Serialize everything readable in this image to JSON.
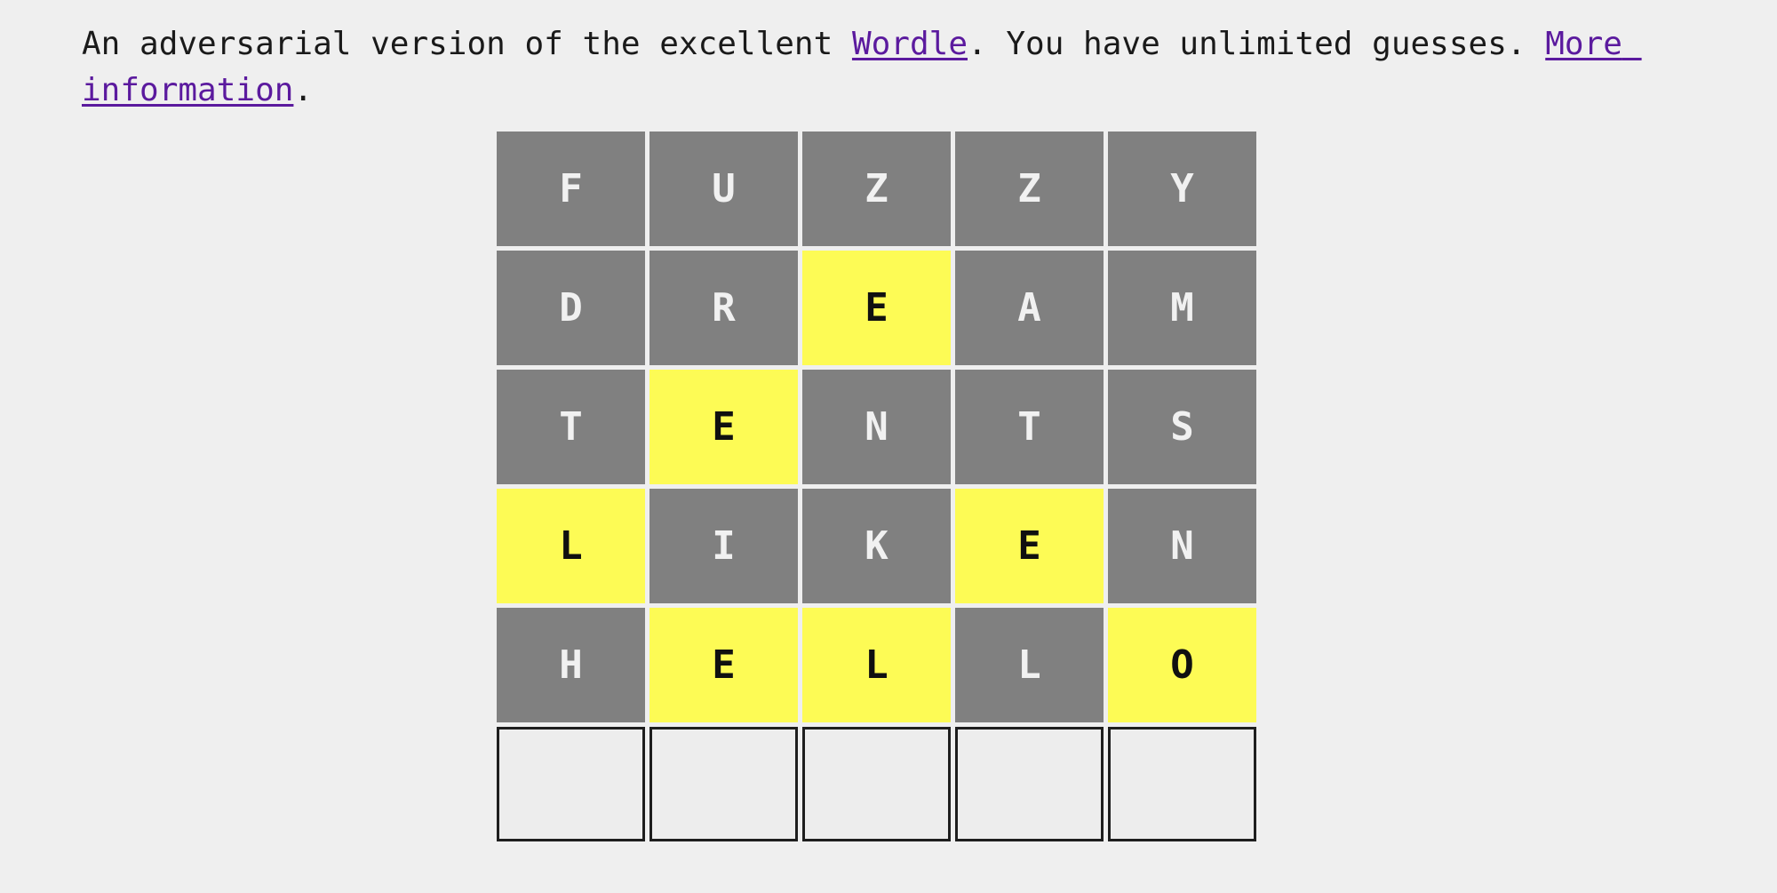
{
  "page": {
    "background_color": "#efefef",
    "link_color": "#5b1a9e"
  },
  "intro": {
    "text_before_link1": "An adversarial version of the excellent ",
    "link1_label": "Wordle",
    "text_between_links": ". You have unlimited guesses. ",
    "link2_label": "More information",
    "text_after_link2": "."
  },
  "board": {
    "columns": 5,
    "rows": 6,
    "tile_colors": {
      "absent": "#808080",
      "present": "#fdfb55",
      "empty": "#ededed",
      "absent_text": "#f1f1f1",
      "present_text": "#101010",
      "empty_border": "#1e1e1e"
    },
    "guesses": [
      {
        "word": "FUZZY",
        "tiles": [
          {
            "letter": "F",
            "state": "absent"
          },
          {
            "letter": "U",
            "state": "absent"
          },
          {
            "letter": "Z",
            "state": "absent"
          },
          {
            "letter": "Z",
            "state": "absent"
          },
          {
            "letter": "Y",
            "state": "absent"
          }
        ]
      },
      {
        "word": "DREAM",
        "tiles": [
          {
            "letter": "D",
            "state": "absent"
          },
          {
            "letter": "R",
            "state": "absent"
          },
          {
            "letter": "E",
            "state": "present"
          },
          {
            "letter": "A",
            "state": "absent"
          },
          {
            "letter": "M",
            "state": "absent"
          }
        ]
      },
      {
        "word": "TENTS",
        "tiles": [
          {
            "letter": "T",
            "state": "absent"
          },
          {
            "letter": "E",
            "state": "present"
          },
          {
            "letter": "N",
            "state": "absent"
          },
          {
            "letter": "T",
            "state": "absent"
          },
          {
            "letter": "S",
            "state": "absent"
          }
        ]
      },
      {
        "word": "LIKEN",
        "tiles": [
          {
            "letter": "L",
            "state": "present"
          },
          {
            "letter": "I",
            "state": "absent"
          },
          {
            "letter": "K",
            "state": "absent"
          },
          {
            "letter": "E",
            "state": "present"
          },
          {
            "letter": "N",
            "state": "absent"
          }
        ]
      },
      {
        "word": "HELLO",
        "tiles": [
          {
            "letter": "H",
            "state": "absent"
          },
          {
            "letter": "E",
            "state": "present"
          },
          {
            "letter": "L",
            "state": "present"
          },
          {
            "letter": "L",
            "state": "absent"
          },
          {
            "letter": "O",
            "state": "present"
          }
        ]
      }
    ],
    "input_row": {
      "tiles": [
        {
          "letter": "",
          "state": "empty"
        },
        {
          "letter": "",
          "state": "empty"
        },
        {
          "letter": "",
          "state": "empty"
        },
        {
          "letter": "",
          "state": "empty"
        },
        {
          "letter": "",
          "state": "empty"
        }
      ]
    }
  }
}
